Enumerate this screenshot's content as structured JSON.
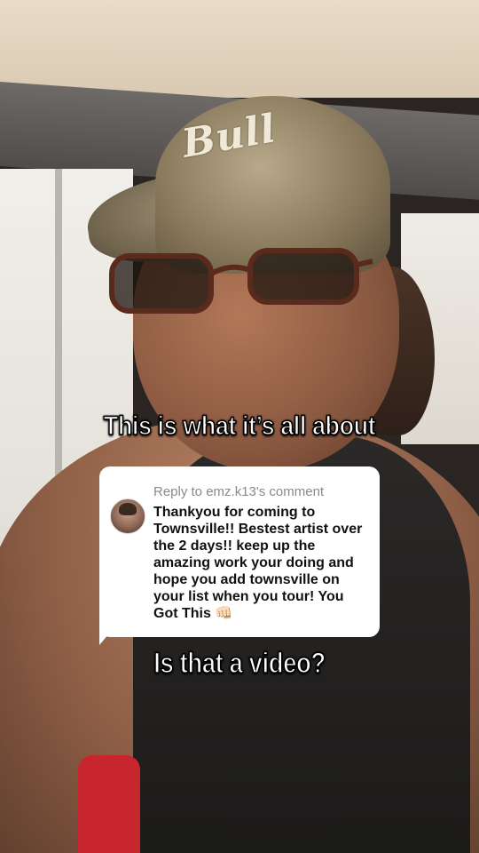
{
  "video": {
    "cap_logo": "Bull",
    "caption_top": "This is what it’s all about",
    "caption_bottom": "Is that a video?"
  },
  "reply": {
    "header": "Reply to emz.k13's comment",
    "comment_text": "Thankyou for coming to Townsville!! Bestest artist over the 2 days!! keep up the amazing work your doing and hope you add townsville on your list when you tour! You Got This 👊🏻",
    "emoji_icon": "fist-bump-emoji"
  },
  "colors": {
    "card_background": "#ffffff",
    "caption_text": "#ffffff",
    "caption_outline": "#000000",
    "header_text": "#8a8a8a"
  }
}
